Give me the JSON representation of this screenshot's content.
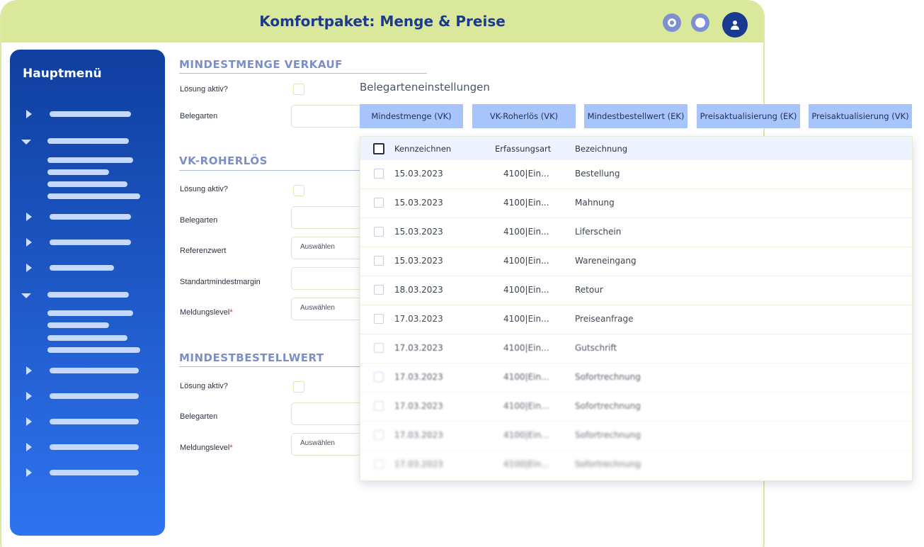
{
  "app": {
    "title": "Komfortpaket: Menge & Preise"
  },
  "header_icons": [
    "settings-ring-icon",
    "circle-icon",
    "user-icon"
  ],
  "sidebar": {
    "title": "Hauptmenü"
  },
  "sections": {
    "verkauf": {
      "title": "MINDESTMENGE VERKAUF",
      "loesung": "Lösung aktiv?",
      "belegarten": "Belegarten"
    },
    "roherloes": {
      "title": "VK-ROHERLÖS",
      "loesung": "Lösung aktiv?",
      "belegarten": "Belegarten",
      "referenzwert": "Referenzwert",
      "referenzwert_value": "Auswählen",
      "standard": "Standartmindestmargin",
      "meldungslevel": "Meldungslevel",
      "meldungslevel_value": "Auswählen"
    },
    "bestellwert": {
      "title": "MINDESTBESTELLWERT",
      "loesung": "Lösung aktiv?",
      "belegarten": "Belegarten",
      "meldungslevel": "Meldungslevel",
      "meldungslevel_value": "Auswählen"
    },
    "required_marker": "*"
  },
  "beleg": {
    "title": "Belegarteneinstellungen",
    "tabs": [
      "Mindestmenge (VK)",
      "VK-Roherlös (VK)",
      "Mindestbestellwert (EK)",
      "Preisaktualisierung (EK)",
      "Preisaktualisierung (VK)"
    ],
    "columns": [
      "Kennzeichnen",
      "Erfassungsart",
      "Bezeichnung"
    ],
    "rows": [
      {
        "date": "15.03.2023",
        "art": "4100|Ein...",
        "name": "Bestellung"
      },
      {
        "date": "15.03.2023",
        "art": "4100|Ein...",
        "name": "Mahnung"
      },
      {
        "date": "15.03.2023",
        "art": "4100|Ein...",
        "name": "Liferschein"
      },
      {
        "date": "15.03.2023",
        "art": "4100|Ein...",
        "name": "Wareneingang"
      },
      {
        "date": "18.03.2023",
        "art": "4100|Ein...",
        "name": "Retour"
      },
      {
        "date": "17.03.2023",
        "art": "4100|Ein...",
        "name": "Preiseanfrage"
      },
      {
        "date": "17.03.2023",
        "art": "4100|Ein...",
        "name": "Gutschrift"
      },
      {
        "date": "17.03.2023",
        "art": "4100|Ein...",
        "name": "Sofortrechnung"
      },
      {
        "date": "17.03.2023",
        "art": "4100|Ein...",
        "name": "Sofortrechnung"
      },
      {
        "date": "17.03.2023",
        "art": "4100|Ein...",
        "name": "Sofortrechnung"
      },
      {
        "date": "17.03.2023",
        "art": "4100|Ein...",
        "name": "Sofortrechnung"
      }
    ]
  },
  "colors": {
    "brand": "#1e3a8a",
    "topbar": "#dae89b",
    "tab": "#a8c5fb",
    "section": "#7b8fc6"
  }
}
